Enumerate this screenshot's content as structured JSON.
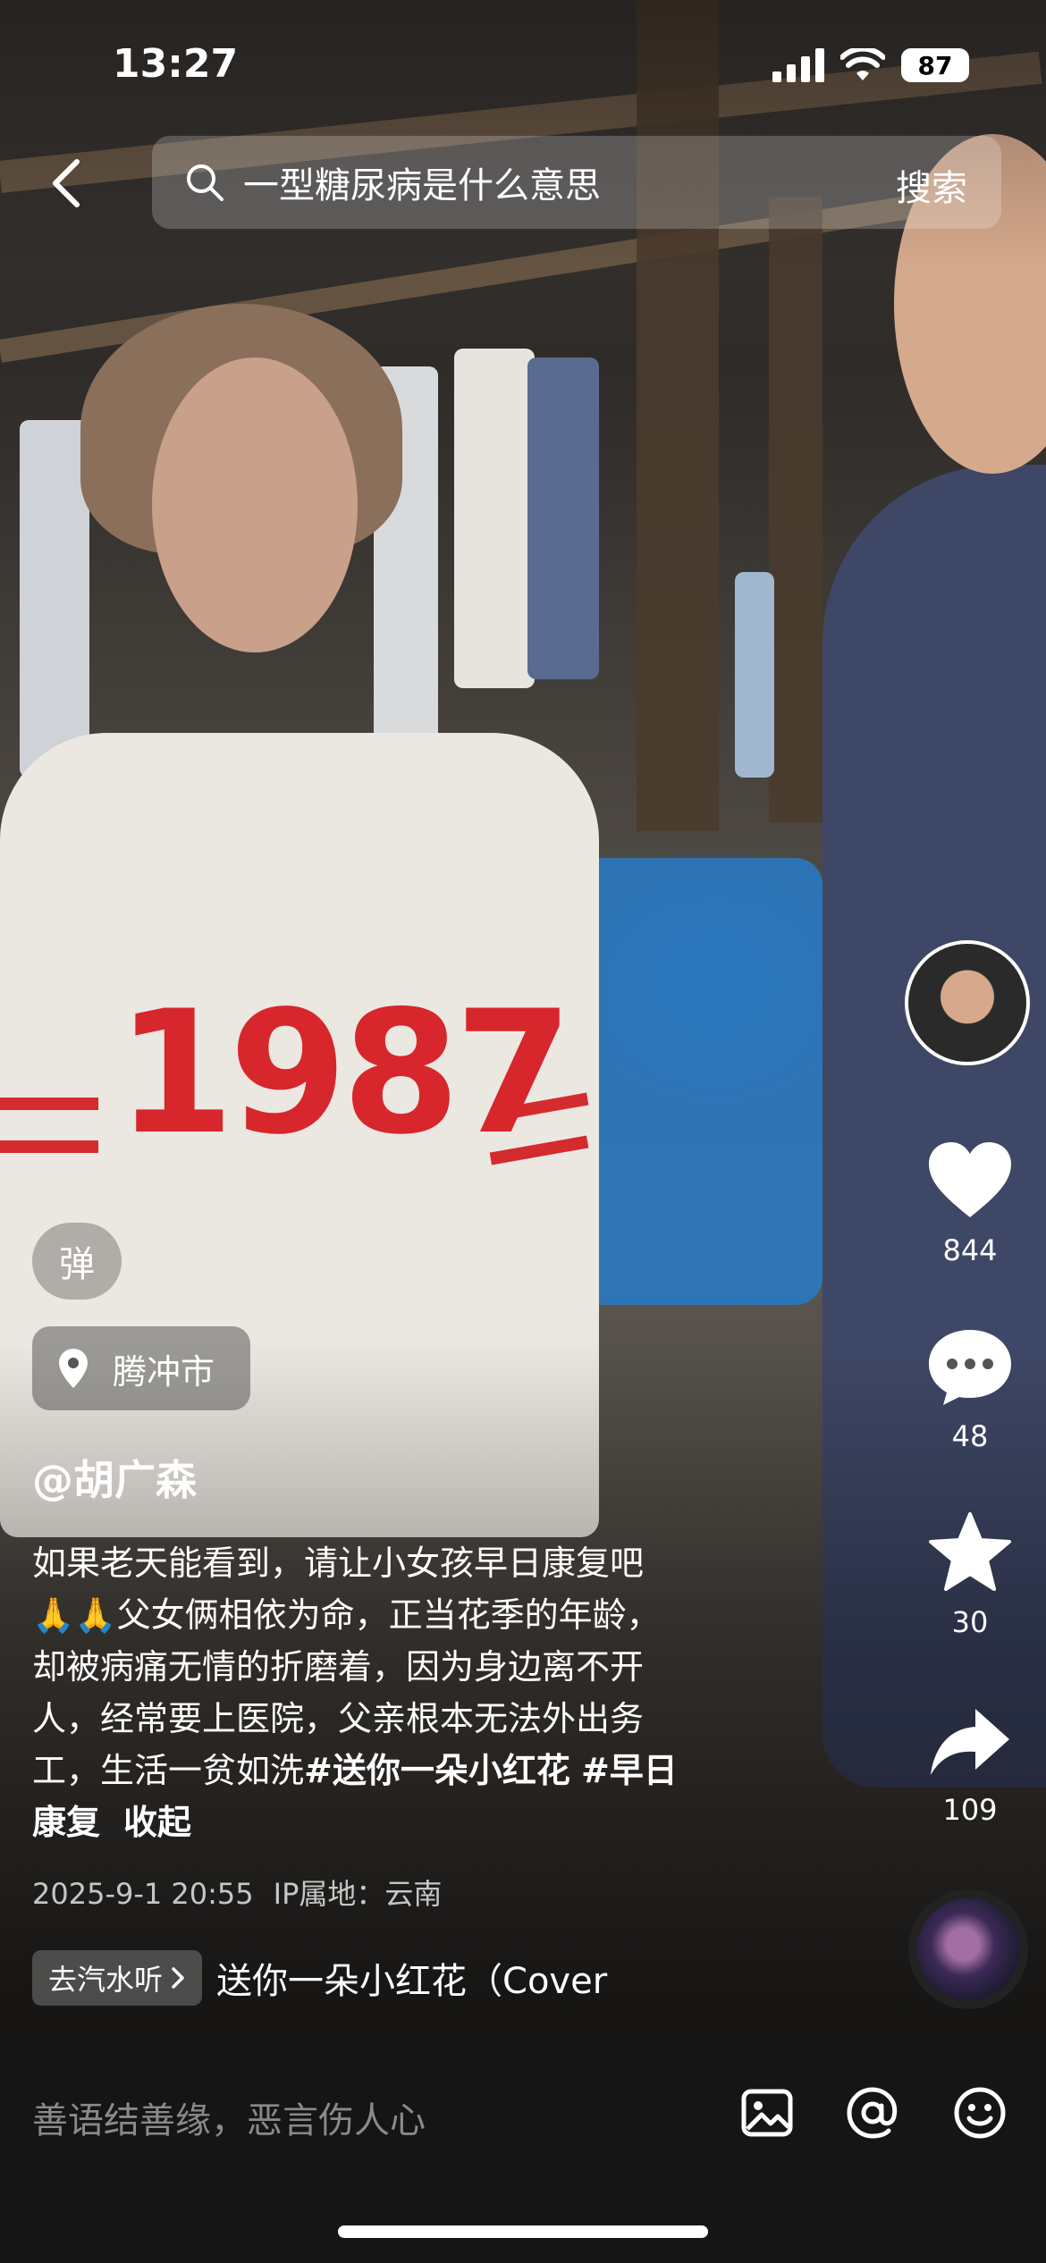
{
  "status_bar": {
    "time": "13:27",
    "battery": "87"
  },
  "search": {
    "query": "一型糖尿病是什么意思",
    "button": "搜索"
  },
  "video_overlay": {
    "shirt_number": "1987"
  },
  "sidebar": {
    "likes": "844",
    "comments": "48",
    "favorites": "30",
    "shares": "109"
  },
  "danmu_label": "弹",
  "location": "腾冲市",
  "author": "@胡广森",
  "caption": {
    "line1": "如果老天能看到，请让小女孩早日康复吧",
    "line2_emoji": "🙏🙏",
    "line2": "父女俩相依为命，正当花季的年龄，",
    "line3": "却被病痛无情的折磨着，因为身边离不开",
    "line4": "人，经常要上医院，父亲根本无法外出务",
    "line5": "工，生活一贫如洗",
    "tag1": "#送你一朵小红花",
    "tag2": "#早日",
    "line6_tag": "康复",
    "collapse": "收起"
  },
  "meta": {
    "date": "2025-9-1 20:55",
    "ip": "IP属地：云南"
  },
  "music": {
    "chip": "去汽水听",
    "title": "送你一朵小红花（Cover"
  },
  "comment_placeholder": "善语结善缘，恶言伤人心",
  "colors": {
    "accent": "#d7262c",
    "bottom_bar": "#151515"
  }
}
